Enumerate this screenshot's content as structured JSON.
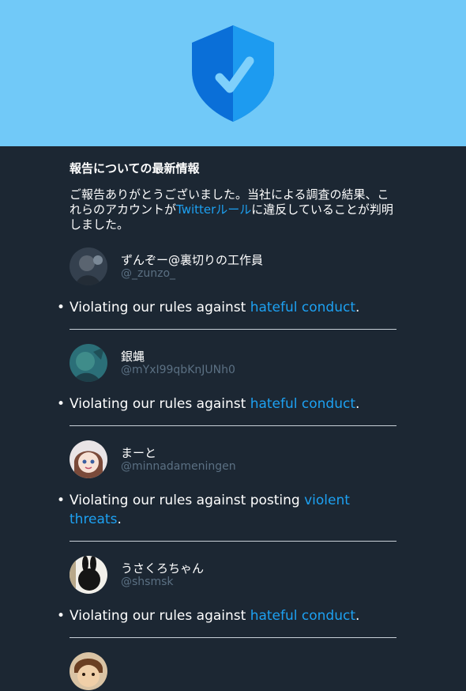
{
  "header": {
    "icon": "shield-check-icon",
    "background": "#71c9f8"
  },
  "heading": "報告についての最新情報",
  "intro": {
    "before": "ご報告ありがとうございました。当社による調査の結果、これらのアカウントが",
    "link": "Twitterルール",
    "after": "に違反していることが判明しました。"
  },
  "accounts": [
    {
      "display_name": "ずんぞー@裏切りの工作員",
      "handle": "@_zunzo_",
      "avatar": "avatar-dark-figure",
      "violation": {
        "before": "Violating our rules against ",
        "link": "hateful conduct",
        "after": "."
      }
    },
    {
      "display_name": "銀蝿",
      "handle": "@mYxI99qbKnJUNh0",
      "avatar": "avatar-teal-creature",
      "violation": {
        "before": "Violating our rules against ",
        "link": "hateful conduct",
        "after": "."
      }
    },
    {
      "display_name": "まーと",
      "handle": "@minnadameningen",
      "avatar": "avatar-anime-girl",
      "violation": {
        "before": "Violating our rules against posting ",
        "link": "violent threats",
        "after": "."
      }
    },
    {
      "display_name": "うさくろちゃん",
      "handle": "@shsmsk",
      "avatar": "avatar-black-bunny",
      "violation": {
        "before": "Violating our rules against ",
        "link": "hateful conduct",
        "after": "."
      }
    }
  ],
  "colors": {
    "background": "#1c2733",
    "link": "#1da1f2",
    "muted": "#5b7083"
  }
}
